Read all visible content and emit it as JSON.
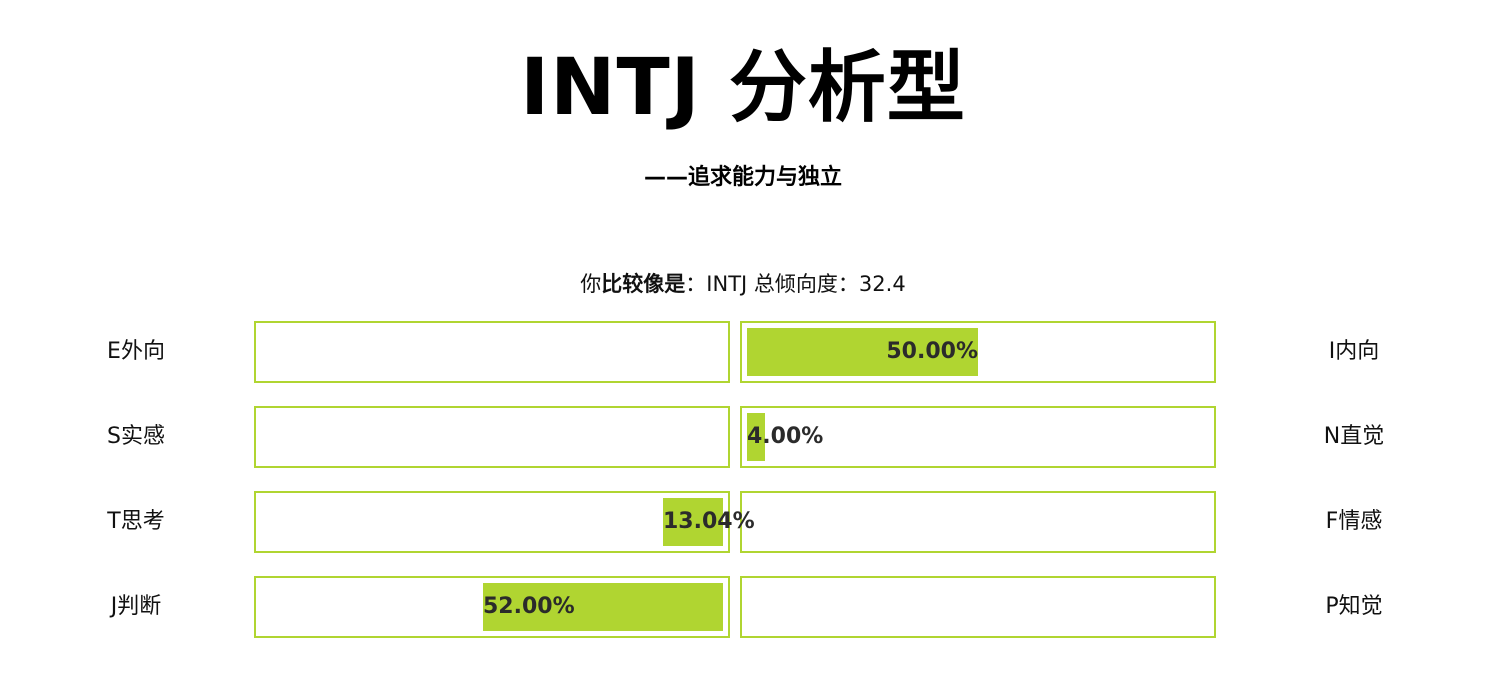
{
  "header": {
    "title": "INTJ 分析型",
    "subtitle": "——追求能力与独立"
  },
  "summary": {
    "prefix": "你",
    "emphasis": "比较像是",
    "colon": "：",
    "type": "INTJ",
    "total_label": " 总倾向度：",
    "total_value": "32.4"
  },
  "colors": {
    "bar_fill": "#b0d531",
    "bar_border": "#b0d531"
  },
  "dimensions": [
    {
      "left_label": "E外向",
      "right_label": "I内向",
      "side": "right",
      "percent": 50.0,
      "percent_text": "50.00%"
    },
    {
      "left_label": "S实感",
      "right_label": "N直觉",
      "side": "right",
      "percent": 4.0,
      "percent_text": "4.00%"
    },
    {
      "left_label": "T思考",
      "right_label": "F情感",
      "side": "left",
      "percent": 13.04,
      "percent_text": "13.04%"
    },
    {
      "left_label": "J判断",
      "right_label": "P知觉",
      "side": "left",
      "percent": 52.0,
      "percent_text": "52.00%"
    }
  ]
}
